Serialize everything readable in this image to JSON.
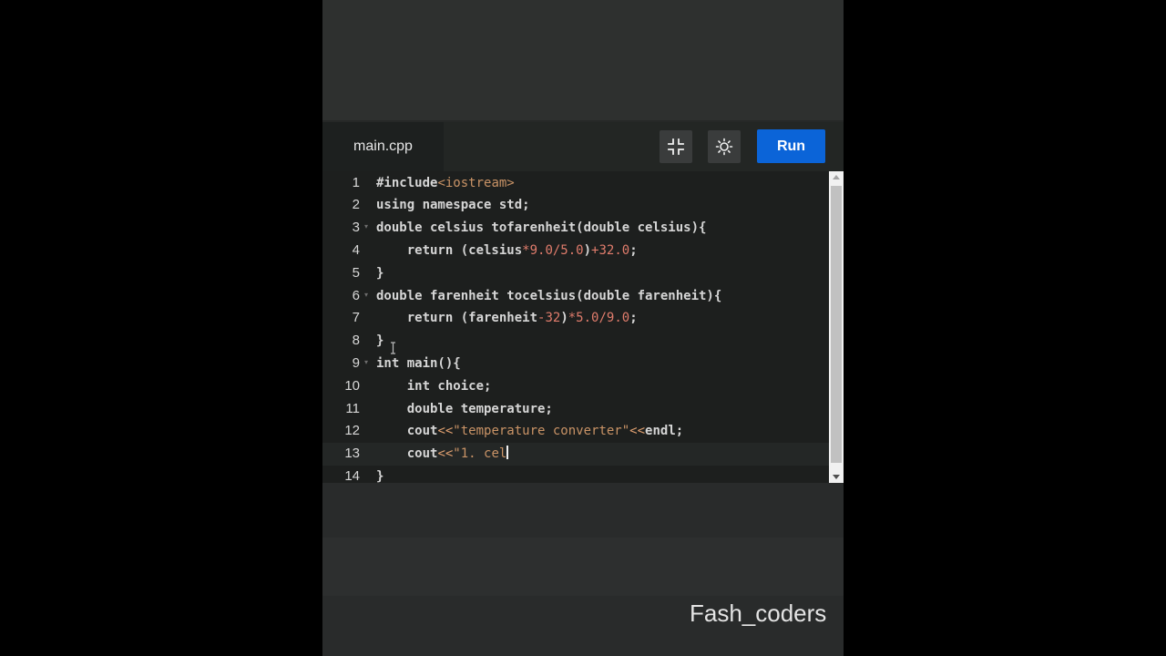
{
  "editor": {
    "filename": "main.cpp",
    "run_label": "Run",
    "lines": [
      {
        "n": "1",
        "fold": "",
        "tokens": [
          {
            "t": "#include",
            "c": ""
          },
          {
            "t": "<iostream>",
            "c": "str"
          }
        ]
      },
      {
        "n": "2",
        "fold": "",
        "tokens": [
          {
            "t": "using namespace std;",
            "c": ""
          }
        ]
      },
      {
        "n": "3",
        "fold": "▾",
        "tokens": [
          {
            "t": "double celsius tofarenheit(double celsius){",
            "c": ""
          }
        ]
      },
      {
        "n": "4",
        "fold": "",
        "tokens": [
          {
            "t": "    return (celsius",
            "c": ""
          },
          {
            "t": "*9.0/5.0",
            "c": "num"
          },
          {
            "t": ")",
            "c": ""
          },
          {
            "t": "+32.0",
            "c": "num"
          },
          {
            "t": ";",
            "c": ""
          }
        ]
      },
      {
        "n": "5",
        "fold": "",
        "tokens": [
          {
            "t": "}",
            "c": ""
          }
        ]
      },
      {
        "n": "6",
        "fold": "▾",
        "tokens": [
          {
            "t": "double farenheit tocelsius(double farenheit){",
            "c": ""
          }
        ]
      },
      {
        "n": "7",
        "fold": "",
        "tokens": [
          {
            "t": "    return (farenheit",
            "c": ""
          },
          {
            "t": "-32",
            "c": "num"
          },
          {
            "t": ")",
            "c": ""
          },
          {
            "t": "*5.0/9.0",
            "c": "num"
          },
          {
            "t": ";",
            "c": ""
          }
        ]
      },
      {
        "n": "8",
        "fold": "",
        "tokens": [
          {
            "t": "}",
            "c": ""
          }
        ]
      },
      {
        "n": "9",
        "fold": "▾",
        "tokens": [
          {
            "t": "int main(){",
            "c": ""
          }
        ]
      },
      {
        "n": "10",
        "fold": "",
        "tokens": [
          {
            "t": "    int choice;",
            "c": ""
          }
        ]
      },
      {
        "n": "11",
        "fold": "",
        "tokens": [
          {
            "t": "    double temperature;",
            "c": ""
          }
        ]
      },
      {
        "n": "12",
        "fold": "",
        "tokens": [
          {
            "t": "    cout",
            "c": ""
          },
          {
            "t": "<<",
            "c": "op"
          },
          {
            "t": "\"temperature converter\"",
            "c": "str"
          },
          {
            "t": "<<",
            "c": "op"
          },
          {
            "t": "endl;",
            "c": ""
          }
        ]
      },
      {
        "n": "13",
        "fold": "",
        "active": true,
        "cursor": true,
        "tokens": [
          {
            "t": "    cout",
            "c": ""
          },
          {
            "t": "<<",
            "c": "op"
          },
          {
            "t": "\"1. cel",
            "c": "str"
          }
        ]
      },
      {
        "n": "14",
        "fold": "",
        "tokens": [
          {
            "t": "}",
            "c": ""
          }
        ]
      }
    ]
  },
  "watermark": "Fash_coders",
  "icons": {
    "collapse": "collapse-icon",
    "theme": "sun-icon"
  },
  "colors": {
    "run_button": "#0b64d8",
    "editor_bg": "#1d1f1e",
    "string": "#c99366",
    "number": "#e07c6c"
  }
}
